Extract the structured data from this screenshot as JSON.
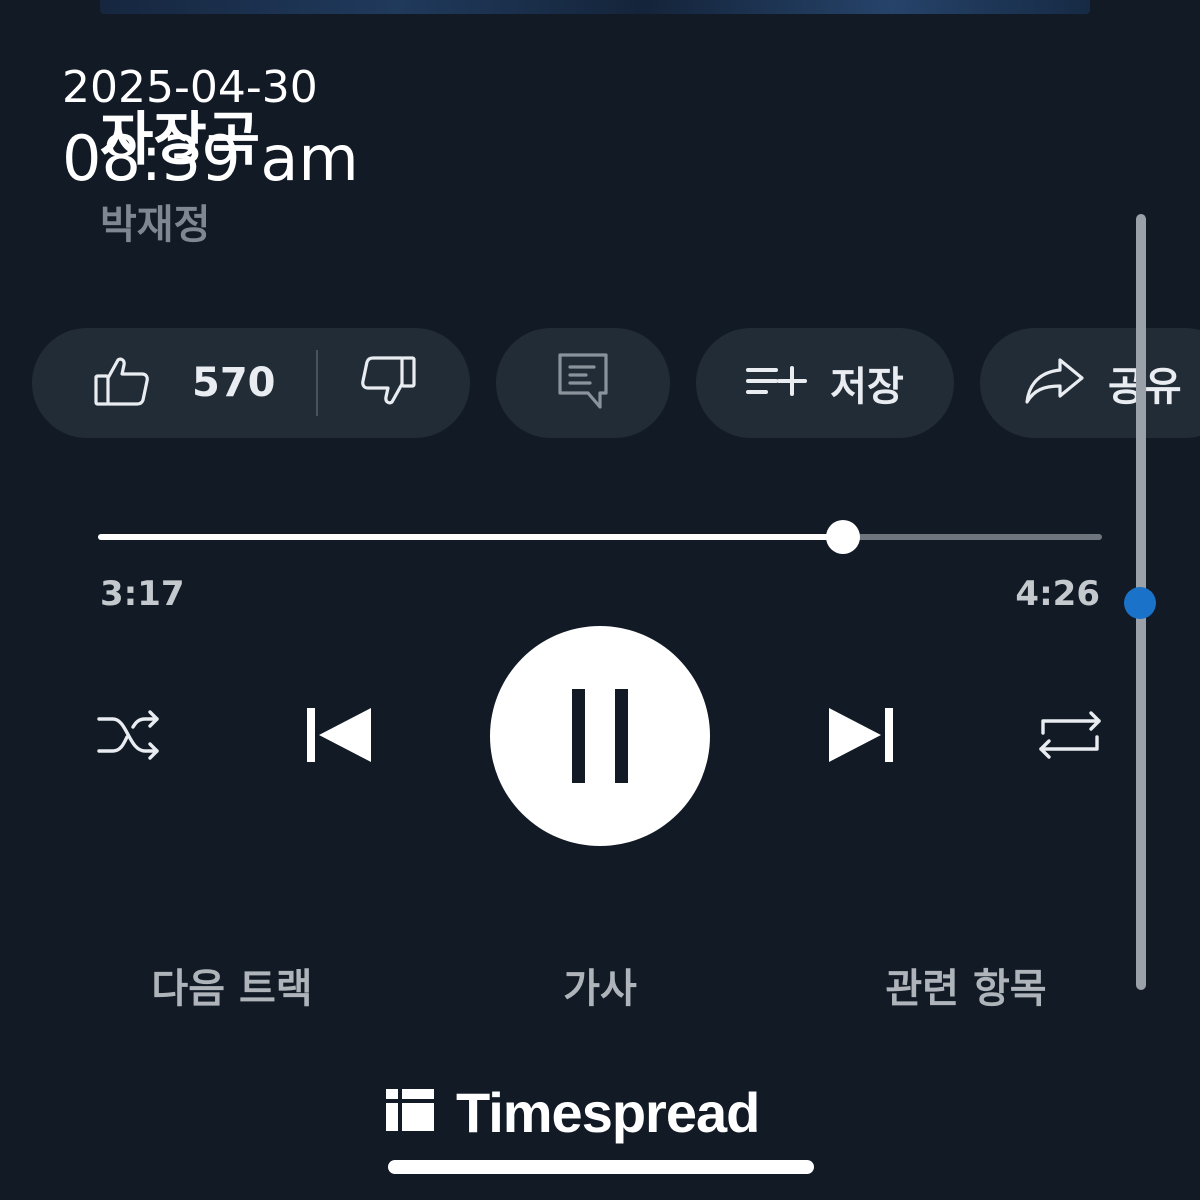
{
  "song": {
    "title": "자장곡",
    "artist": "박재정"
  },
  "timestamp": {
    "date": "2025-04-30",
    "time": "08:39 am"
  },
  "actions": {
    "like_count": "570",
    "like_icon": "thumbs-up-icon",
    "dislike_icon": "thumbs-down-icon",
    "comment_icon": "comment-icon",
    "save_icon": "playlist-add-icon",
    "save_label": "저장",
    "share_icon": "share-arrow-icon",
    "share_label": "공유"
  },
  "playback": {
    "current_time": "3:17",
    "total_time": "4:26",
    "progress_fraction": 0.742,
    "state": "playing"
  },
  "controls": {
    "shuffle_icon": "shuffle-icon",
    "previous_icon": "skip-previous-icon",
    "pause_icon": "pause-icon",
    "next_icon": "skip-next-icon",
    "repeat_icon": "repeat-icon"
  },
  "tabs": [
    {
      "label": "다음 트랙"
    },
    {
      "label": "가사"
    },
    {
      "label": "관련 항목"
    }
  ],
  "brand": {
    "name": "Timespread",
    "logo_icon": "timespread-logo-icon"
  },
  "colors": {
    "background": "#111a25",
    "pill": "#222c36",
    "scroll_thumb": "#1a73c9"
  }
}
